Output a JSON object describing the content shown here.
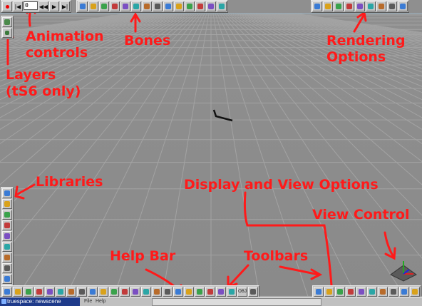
{
  "app": {
    "taskbar_title": "truespace: newscene",
    "menu": [
      "File",
      "Help"
    ]
  },
  "animation_controls": {
    "frame_value": "0",
    "buttons": [
      "record-icon",
      "go-start-icon",
      "frame-field",
      "step-back-icon",
      "play-icon",
      "go-end-icon"
    ]
  },
  "layers": {
    "buttons": [
      "layer-icon",
      "add-layer-icon"
    ]
  },
  "annotations": {
    "layers": "Layers\n(tS6 only)",
    "animation": "Animation\ncontrols",
    "bones": "Bones",
    "rendering": "Rendering\nOptions",
    "libraries": "Libraries",
    "display": "Display and View Options",
    "view_control": "View Control",
    "help_bar": "Help Bar",
    "toolbars": "Toolbars"
  },
  "toolbars": {
    "top_main": [
      "select-icon",
      "move-icon",
      "rotate-icon",
      "scale-icon",
      "bones-icon",
      "skin-icon",
      "ik-icon",
      "joint-icon",
      "deform-icon",
      "path-icon",
      "material-icon",
      "object-tool-icon",
      "trash-icon",
      "undo-icon"
    ],
    "render": [
      "render-object-icon",
      "render-scene-icon",
      "render-region-icon",
      "render-file-icon",
      "render-options-icon",
      "light-icon",
      "camera-icon",
      "view-icon",
      "grid-icon"
    ],
    "libraries": [
      "library-open-icon",
      "material-library-icon",
      "paint-library-icon",
      "object-library-icon",
      "plugin-library-icon",
      "animation-library-icon",
      "light-library-icon",
      "environment-library-icon",
      "tool-library-icon",
      "script-library-icon"
    ],
    "bottom_main": [
      "cone-icon",
      "sphere-icon",
      "polygon-icon",
      "text-icon",
      "select-icon",
      "deform-icon",
      "boolean-icon",
      "sweep-icon",
      "lathe-icon",
      "primitive-icon",
      "extrude-icon",
      "spline-icon",
      "curve-icon",
      "material-icon",
      "point-edit-icon",
      "edge-icon",
      "face-icon",
      "object-icon",
      "light-icon",
      "camera-icon",
      "axis-icon",
      "character-icon",
      "obj-icon",
      "anim-icon"
    ],
    "bottom_obj_label": "OBJ",
    "display_options": [
      "render-quality-icon",
      "wireframe-icon",
      "display-view-icon",
      "grid-display-icon",
      "perspective-icon",
      "top-view-icon",
      "camera-view-icon",
      "new-view-icon",
      "view-layout-icon",
      "view-close-icon"
    ]
  },
  "colors": {
    "floor": "#8a8a8a",
    "grid_line": "#a2a2a2",
    "annotation": "#ff1a1a",
    "horizon": "#9fb8c8",
    "ui_gray": "#c0c0c0",
    "taskbar_active": "#1e3a8a"
  }
}
